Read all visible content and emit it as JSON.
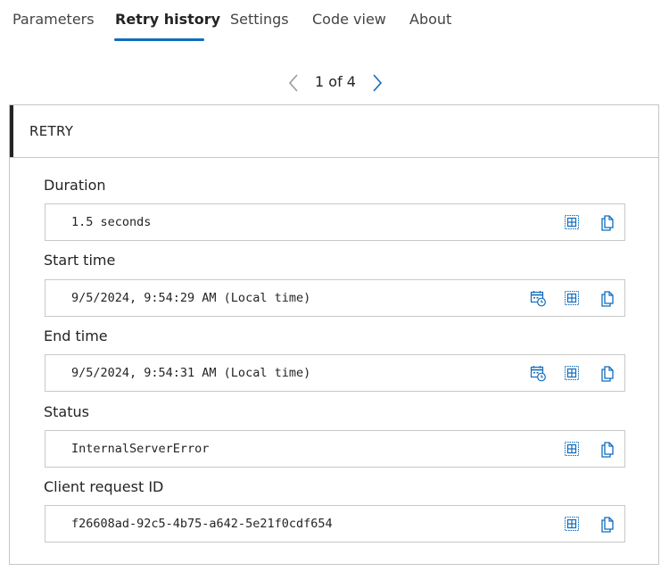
{
  "tabs": [
    {
      "label": "Parameters"
    },
    {
      "label": "Retry history"
    },
    {
      "label": "Settings"
    },
    {
      "label": "Code view"
    },
    {
      "label": "About"
    }
  ],
  "active_tab": "Retry history",
  "pager": {
    "text": "1 of 4"
  },
  "card": {
    "title": "RETRY"
  },
  "fields": [
    {
      "label": "Duration",
      "value": "1.5 seconds",
      "icons": [
        "expand-icon",
        "copy-icon"
      ]
    },
    {
      "label": "Start time",
      "value": "9/5/2024, 9:54:29 AM (Local time)",
      "icons": [
        "calendar-clock-icon",
        "expand-icon",
        "copy-icon"
      ]
    },
    {
      "label": "End time",
      "value": "9/5/2024, 9:54:31 AM (Local time)",
      "icons": [
        "calendar-clock-icon",
        "expand-icon",
        "copy-icon"
      ]
    },
    {
      "label": "Status",
      "value": "InternalServerError",
      "icons": [
        "expand-icon",
        "copy-icon"
      ]
    },
    {
      "label": "Client request ID",
      "value": "f26608ad-92c5-4b75-a642-5e21f0cdf654",
      "icons": [
        "expand-icon",
        "copy-icon"
      ]
    }
  ],
  "colors": {
    "accent": "#0f6cbd",
    "text": "#242424",
    "border": "#c8c8c8"
  }
}
